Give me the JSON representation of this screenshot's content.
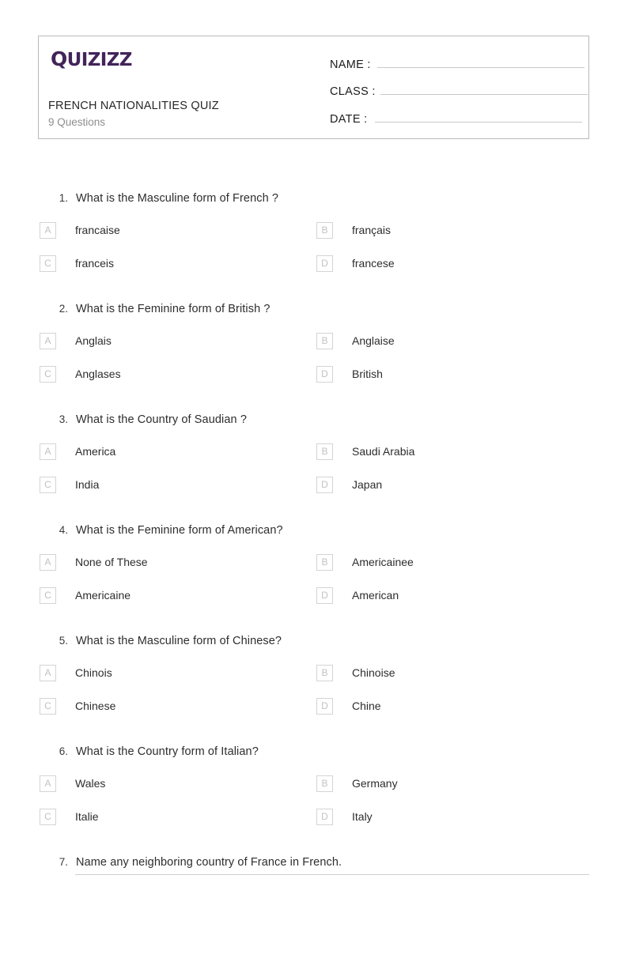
{
  "brand": {
    "logo_cap": "Q",
    "logo_rest": "UIZIZZ",
    "logo_text": "Quizizz",
    "logo_color": "#42245a"
  },
  "header": {
    "title": "FRENCH NATIONALITIES QUIZ",
    "subtitle": "9 Questions",
    "fields": [
      {
        "label": "NAME :"
      },
      {
        "label": "CLASS :"
      },
      {
        "label": "DATE  :"
      }
    ]
  },
  "questions": [
    {
      "number": "1.",
      "text": "What is the Masculine form of French ?",
      "type": "multiple-choice",
      "options": [
        {
          "letter": "A",
          "label": "francaise"
        },
        {
          "letter": "B",
          "label": "français"
        },
        {
          "letter": "C",
          "label": "franceis"
        },
        {
          "letter": "D",
          "label": "francese"
        }
      ]
    },
    {
      "number": "2.",
      "text": "What is the Feminine form of British ?",
      "type": "multiple-choice",
      "options": [
        {
          "letter": "A",
          "label": "Anglais"
        },
        {
          "letter": "B",
          "label": "Anglaise"
        },
        {
          "letter": "C",
          "label": "Anglases"
        },
        {
          "letter": "D",
          "label": "British"
        }
      ]
    },
    {
      "number": "3.",
      "text": "What is the Country of Saudian ?",
      "type": "multiple-choice",
      "options": [
        {
          "letter": "A",
          "label": "America"
        },
        {
          "letter": "B",
          "label": "Saudi Arabia"
        },
        {
          "letter": "C",
          "label": "India"
        },
        {
          "letter": "D",
          "label": "Japan"
        }
      ]
    },
    {
      "number": "4.",
      "text": "What is the Feminine form of American?",
      "type": "multiple-choice",
      "options": [
        {
          "letter": "A",
          "label": "None of These"
        },
        {
          "letter": "B",
          "label": "Americainee"
        },
        {
          "letter": "C",
          "label": "Americaine"
        },
        {
          "letter": "D",
          "label": "American"
        }
      ]
    },
    {
      "number": "5.",
      "text": "What is the Masculine form of Chinese?",
      "type": "multiple-choice",
      "options": [
        {
          "letter": "A",
          "label": "Chinois"
        },
        {
          "letter": "B",
          "label": "Chinoise"
        },
        {
          "letter": "C",
          "label": "Chinese"
        },
        {
          "letter": "D",
          "label": "Chine"
        }
      ]
    },
    {
      "number": "6.",
      "text": "What is the Country form of Italian?",
      "type": "multiple-choice",
      "options": [
        {
          "letter": "A",
          "label": "Wales"
        },
        {
          "letter": "B",
          "label": "Germany"
        },
        {
          "letter": "C",
          "label": "Italie"
        },
        {
          "letter": "D",
          "label": "Italy"
        }
      ]
    },
    {
      "number": "7.",
      "text": "Name any neighboring country of France in French.",
      "type": "short-answer",
      "options": []
    }
  ]
}
